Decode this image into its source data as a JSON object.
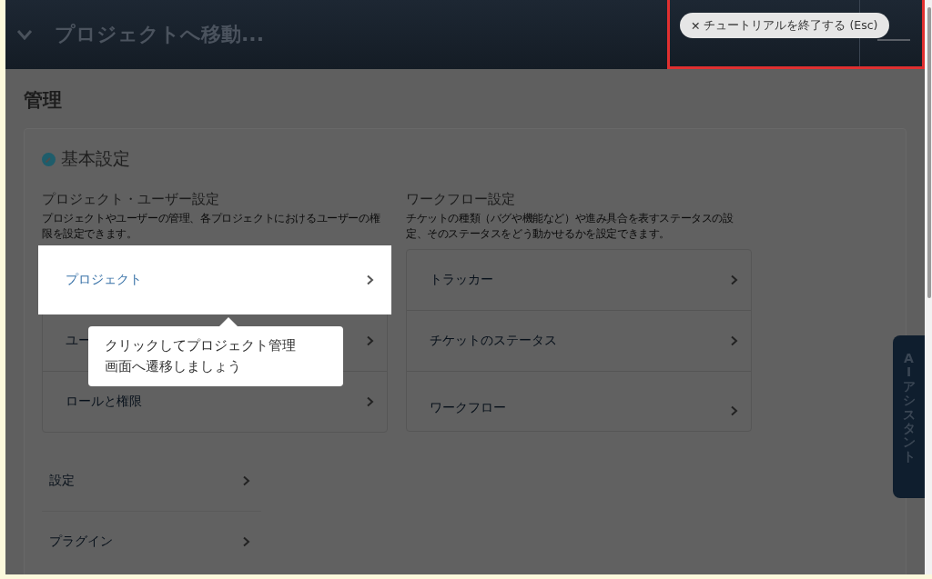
{
  "header": {
    "title": "プロジェクトへ移動...",
    "tutorial_button": {
      "icon": "✕",
      "label": "チュートリアルを終了する (Esc)"
    }
  },
  "page_title": "管理",
  "section": {
    "title": "基本設定",
    "groups": [
      {
        "title": "プロジェクト・ユーザー設定",
        "description": "プロジェクトやユーザーの管理、各プロジェクトにおけるユーザーの権限を設定できます。",
        "items": [
          {
            "label": "プロジェクト",
            "highlighted": true
          },
          {
            "label": "ユー",
            "highlighted": false
          },
          {
            "label": "ロールと権限",
            "highlighted": false
          }
        ]
      },
      {
        "title": "ワークフロー設定",
        "description": "チケットの種類（バグや機能など）や進み具合を表すステータスの設定、そのステータスをどう動かせるかを設定できます。",
        "items": [
          {
            "label": "トラッカー",
            "highlighted": false
          },
          {
            "label": "チケットのステータス",
            "highlighted": false
          },
          {
            "label": "ワークフロー",
            "highlighted": false
          }
        ]
      }
    ],
    "extra_items": [
      {
        "label": "設定"
      },
      {
        "label": "プラグイン"
      }
    ]
  },
  "tooltip": {
    "lines": [
      "クリックしてプロジェクト管理",
      "画面へ遷移しましょう"
    ]
  },
  "assistant_tab": "AIアシスタント"
}
